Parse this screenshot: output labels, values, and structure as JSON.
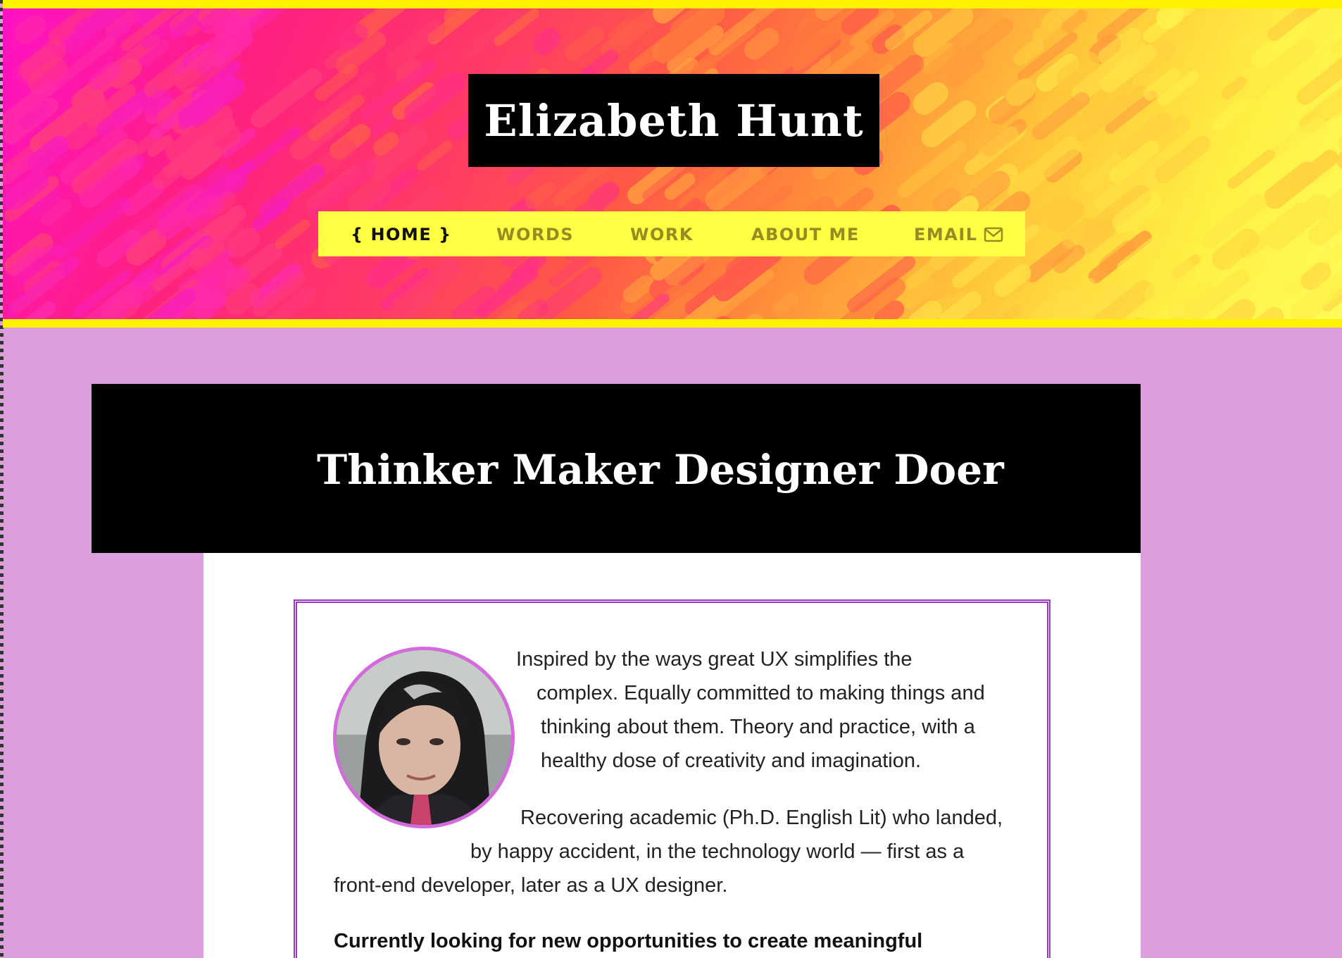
{
  "site": {
    "title": "Elizabeth Hunt"
  },
  "nav": {
    "items": [
      {
        "label": "{ HOME }",
        "active": true
      },
      {
        "label": "WORDS",
        "active": false
      },
      {
        "label": "WORK",
        "active": false
      },
      {
        "label": "ABOUT ME",
        "active": false
      },
      {
        "label": "EMAIL",
        "icon": "envelope-icon",
        "active": false
      }
    ]
  },
  "hero": {
    "title": "Thinker Maker Designer Doer"
  },
  "intro": {
    "p1": [
      "Inspired by the ways great UX simplifies the",
      "complex. Equally committed to making things and",
      "thinking about them. Theory and practice, with a",
      "healthy dose of creativity and imagination."
    ],
    "p2": [
      "Recovering academic (Ph.D. English Lit) who landed,",
      "by happy accident, in the technology world — first as a",
      "front-end developer, later as a UX designer."
    ],
    "p3": "Currently looking for new opportunities to create meaningful"
  },
  "colors": {
    "accent_yellow": "#fff200",
    "nav_bg": "#ffff44",
    "page_bg": "#dd9ede",
    "card_border": "#9a3bbf",
    "avatar_ring": "#d46bdc"
  }
}
